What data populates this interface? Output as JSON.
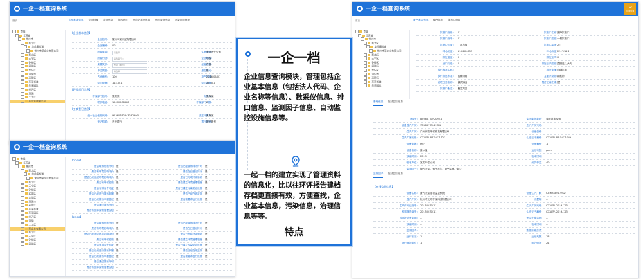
{
  "app": {
    "title": "一企一档查询系统",
    "search_label": "查询企业",
    "search_icon": "magnifier-icon",
    "accent": "#1f73d9",
    "btn_color": "#e9a318"
  },
  "win1": {
    "tabs": [
      "企业基本信息",
      "企业档案",
      "监测信息",
      "排污许可",
      "危险化学品信息",
      "危险废物信息",
      "污染设施管理"
    ],
    "crumb": "首页",
    "tree": [
      "市级",
      "江苏省",
      "常州市",
      "新北区",
      "龙虎塘街道",
      "常州市某企业有限公司",
      "新北区",
      "天宁区",
      "钟楼区",
      "武进区",
      "金坛区",
      "溧阳市",
      "高新区",
      "某某街道",
      "某某园区",
      "经开区",
      "溧阳",
      "二工区",
      "某企业有限公司"
    ],
    "section1": "【企业基本信息】",
    "rows1": [
      {
        "label": "企业名称：",
        "value": "耀州市某汽配有限公司",
        "label2": "",
        "value2": ""
      },
      {
        "label": "企业编号：",
        "value": "001",
        "label2": "",
        "value2": ""
      },
      {
        "label": "所属乡镇：",
        "value": "请选择",
        "label2": "注册类型：",
        "value2": "有限责任公司"
      },
      {
        "label": "所属行业：",
        "value": "请选择行业",
        "label2": "企业规模：",
        "value2": "小型"
      },
      {
        "label": "隶属关系：",
        "value": "市级（单位）",
        "label2": "经营状态：",
        "value2": "在营"
      },
      {
        "label": "单位类型：",
        "value": "请选择",
        "label2": "是否排污：",
        "value2": "是"
      },
      {
        "label": "占地面积：",
        "value": "100",
        "label2": "投产日期：",
        "value2": "2016/05/01"
      },
      {
        "label": "中心经度：",
        "value": "114.601",
        "label2": "中心纬度：",
        "value2": "25.601"
      }
    ],
    "section2": "【环保部门信息】",
    "rows2": [
      {
        "label": "环保部门名称：",
        "value": "张某某",
        "label2": "负责人：",
        "value2": "张某某"
      },
      {
        "label": "联系电话：",
        "value": "15070008888",
        "label2": "环保部门人数：",
        "value2": "2"
      }
    ],
    "section3": "【工商登记信息】",
    "rows3": [
      {
        "label": "统一社会信用代码：",
        "value": "91360782343282990L",
        "label2": "法定代表人：",
        "value2": "黄某某"
      },
      {
        "label": "登记机关：",
        "value": "开户银行",
        "label2": "银行账号：",
        "value2": "银行账号"
      }
    ]
  },
  "win2": {
    "tree": [
      "市级",
      "江苏省",
      "常州市",
      "新北区",
      "龙虎塘街道",
      "常州市某企业有限公司",
      "新北区",
      "天宁区",
      "钟楼区",
      "武进区",
      "金坛区",
      "溧阳市",
      "高新区",
      "某某街道",
      "某某园区",
      "经开区",
      "溧阳",
      "二工区",
      "某企业有限公司",
      "新北区",
      "天宁区",
      "钟楼区",
      "武进区"
    ],
    "year1": "【2019】",
    "year2": "【2018】",
    "left_labels": [
      "是否取得行政许可",
      "是否有环境影响评价",
      "是否已经通过环境影响评价",
      "是否有环保验收",
      "是否有排污许可证",
      "是否已经进行排污申报",
      "是否已经排污申报登记",
      "是否通过排污许可",
      "是否有固体废物管理台账"
    ],
    "right_labels": [
      "是否已经取得排污许可",
      "是否在已登记排污",
      "是否已完成环评验收",
      "是否建立环境管理制度",
      "是否已建立污染防治设施",
      "是否已经在线监测",
      "是否按要求运行设施",
      "",
      ""
    ],
    "value": "是",
    "dash": "--"
  },
  "win3": {
    "tabs": [
      "废气基本信息",
      "废气排放",
      "排放口信息"
    ],
    "crumb": "首页",
    "tree": [
      "市级",
      "江苏省",
      "常州市",
      "新北区",
      "龙虎塘街道",
      "常州市某企业有限公司",
      "新北区",
      "天宁区",
      "钟楼区",
      "武进区",
      "金坛区",
      "溧阳市",
      "高新区",
      "某某街道",
      "某某园区"
    ],
    "rows": [
      {
        "label": "排放口编码：",
        "value": "01",
        "label2": "排放口名称：",
        "value2": "废气排放口"
      },
      {
        "label": "排放口编号：",
        "value": "01",
        "label2": "排放口类型：",
        "value2": "一般排放口"
      },
      {
        "label": "排放口位置：",
        "value": "厂区内部",
        "label2": "排放口高度：",
        "value2": "25"
      },
      {
        "label": "中心经度：",
        "value": "114.806655",
        "label2": "中心纬度：",
        "value2": "25.74111"
      },
      {
        "label": "排放温度：",
        "value": "0",
        "label2": "排放速率：",
        "value2": "0"
      },
      {
        "label": "出口内径：",
        "value": "0",
        "label2": "排放去向类型：",
        "value2": "直接进入大气"
      },
      {
        "label": "执行标准名称：",
        "value": "",
        "label2": "排放规律：",
        "value2": "连续排放"
      },
      {
        "label": "执行排放标准：",
        "value": "国家标准",
        "label2": "主要污染物：",
        "value2": "颗粒物"
      },
      {
        "label": "治理工艺名称：",
        "value": "袋式除尘",
        "label2": "是否安装在线：",
        "value2": "是"
      },
      {
        "label": "排放口备注：",
        "value": "备注内容",
        "label2": "",
        "value2": ""
      }
    ],
    "sub_tabs": [
      "基础信息",
      "在线监控信息"
    ],
    "detail_rows": [
      {
        "label": "MN号：",
        "value": "87088770720051",
        "label2": "监测数据类型：",
        "value2": "实时数据传输"
      },
      {
        "label": "设备生产厂家：",
        "value": "77888773-41501",
        "label2": "生产厂家代码：",
        "value2": ""
      },
      {
        "label": "生产厂家：",
        "value": "广州博控环保科技有限公司",
        "label2": "设备型号：",
        "value2": ""
      },
      {
        "label": "生产厂家代码：",
        "value": "CCAEPI-EP-2017-123",
        "label2": "认证证书编号：",
        "value2": "CCAEPI-EP-2017-056"
      },
      {
        "label": "设备规格：",
        "value": "R37",
        "label2": "设备编号：",
        "value2": "1"
      },
      {
        "label": "设备名称：",
        "value": "废水量",
        "label2": "运行状态：",
        "value2": "ppm"
      },
      {
        "label": "安装时间：",
        "value": "2019",
        "label2": "验收时间：",
        "value2": ""
      },
      {
        "label": "验收单位：",
        "value": "某某环保公司",
        "label2": "维护单位：",
        "value2": "40"
      },
      {
        "label": "监测因子：",
        "value": "烟气流量、烟气压力、烟气温度、烟尘",
        "label2": "",
        "value2": ""
      }
    ],
    "tabs2": [
      "监测因子",
      "在线监控信息"
    ],
    "sec2": "【在线监测信息】",
    "rows2": [
      {
        "label": "设备名称：",
        "value": "废气流量自动监控系统",
        "label2": "设备生产厂家：",
        "value2": "CEMS18012902"
      },
      {
        "label": "生产厂家：",
        "value": "杭州市天环环保科技有限公司",
        "label2": "代理商：",
        "value2": "--"
      },
      {
        "label": "生产许可证编号：",
        "value": "20150030-11",
        "label2": "生产厂家代码：",
        "value2": "CCAEPI-2016-123"
      },
      {
        "label": "检测报告编号：",
        "value": "20150030-11",
        "label2": "认证证书编号：",
        "value2": "CCAEPI-2016-123"
      },
      {
        "label": "检测报告有效期：",
        "value": "--",
        "label2": "是否在线监测：",
        "value2": "--"
      },
      {
        "label": "安装时间：",
        "value": "--",
        "label2": "验收时间：",
        "value2": "--"
      },
      {
        "label": "监测因子：",
        "value": "--",
        "label2": "数据传输方式：",
        "value2": "--"
      },
      {
        "label": "运行状态：",
        "value": "1",
        "label2": "运行天数：",
        "value2": "18"
      },
      {
        "label": "运行维护单位：",
        "value": "1",
        "label2": "维护频次：",
        "value2": "21"
      }
    ]
  },
  "card": {
    "title": "一企一档",
    "para1": "企业信息查询模块，管理包括企业基本信息（包括法人代码、企业名称等信息）、数采仪信息、排口信息、监测因子信息、自动监控设施信息等。",
    "pin_icon": "location-pin-icon",
    "para2": "一起一档的建立实现了管理资料的信息化，比以往环评报告建档存档更直接有效，方便查找，企业基本信息，污染信息，治理信息等等。",
    "label": "特点"
  }
}
